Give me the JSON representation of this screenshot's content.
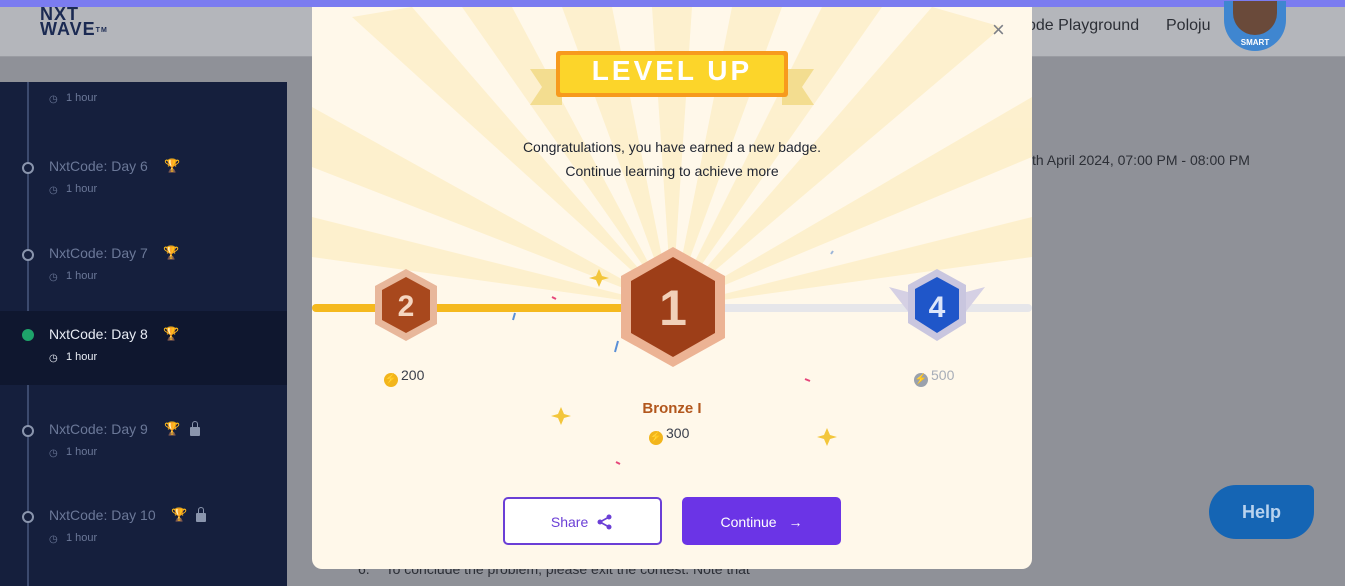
{
  "header": {
    "logo_top": "NXT",
    "logo_bottom": "WAVE",
    "logo_tm": "TM",
    "nav_playground": "ode Playground",
    "user_name": "Poloju",
    "avatar_tag": "SMART"
  },
  "sidebar": {
    "partial_duration": "1 hour",
    "days": [
      {
        "title": "NxtCode: Day 6",
        "duration": "1 hour",
        "status": "pending",
        "locked": false
      },
      {
        "title": "NxtCode: Day 7",
        "duration": "1 hour",
        "status": "pending",
        "locked": false
      },
      {
        "title": "NxtCode: Day 8",
        "duration": "1 hour",
        "status": "completed",
        "locked": false
      },
      {
        "title": "NxtCode: Day 9",
        "duration": "1 hour",
        "status": "locked",
        "locked": true
      },
      {
        "title": "NxtCode: Day 10",
        "duration": "1 hour",
        "status": "locked",
        "locked": true
      }
    ]
  },
  "content": {
    "schedule_text": "th April 2024, 07:00 PM - 08:00 PM",
    "bottom_number": "6.",
    "bottom_text": "To conclude the problem, please exit the contest. Note that"
  },
  "help_button": "Help",
  "modal": {
    "banner": "LEVEL UP",
    "message_line1": "Congratulations, you have earned a new badge.",
    "message_line2": "Continue learning to achieve more",
    "levels": [
      {
        "number": "2",
        "coins": "200",
        "reached": true
      },
      {
        "number": "1",
        "coins": "300",
        "current": true
      },
      {
        "number": "4",
        "coins": "500",
        "reached": false
      }
    ],
    "badge_name": "Bronze I",
    "share_label": "Share",
    "continue_label": "Continue",
    "progress_fraction": 0.47
  },
  "colors": {
    "sidebar_bg": "#151f3d",
    "accent_purple": "#6b34e6",
    "progress_yellow": "#f5b91e",
    "bronze": "#b2571d",
    "help_blue": "#1565b4"
  }
}
